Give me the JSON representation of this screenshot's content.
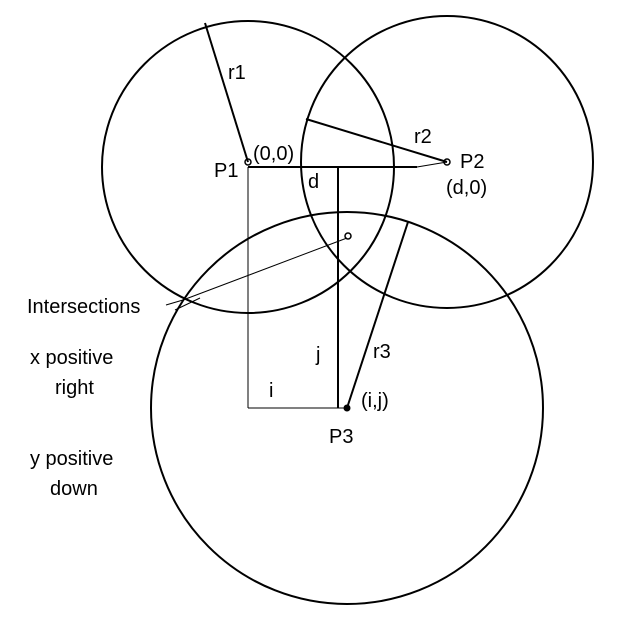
{
  "diagram": {
    "stroke_color": "#000000",
    "background": "#ffffff",
    "labels": {
      "r1": "r1",
      "r2": "r2",
      "r3": "r3",
      "p1": "P1",
      "p1_coord": "(0,0)",
      "p2": "P2",
      "p2_coord": "(d,0)",
      "p3": "P3",
      "p3_coord": "(i,j)",
      "d": "d",
      "i": "i",
      "j": "j",
      "intersections": "Intersections",
      "x_axis_note_line1": "x positive",
      "x_axis_note_line2": "right",
      "y_axis_note_line1": "y positive",
      "y_axis_note_line2": "down"
    }
  }
}
